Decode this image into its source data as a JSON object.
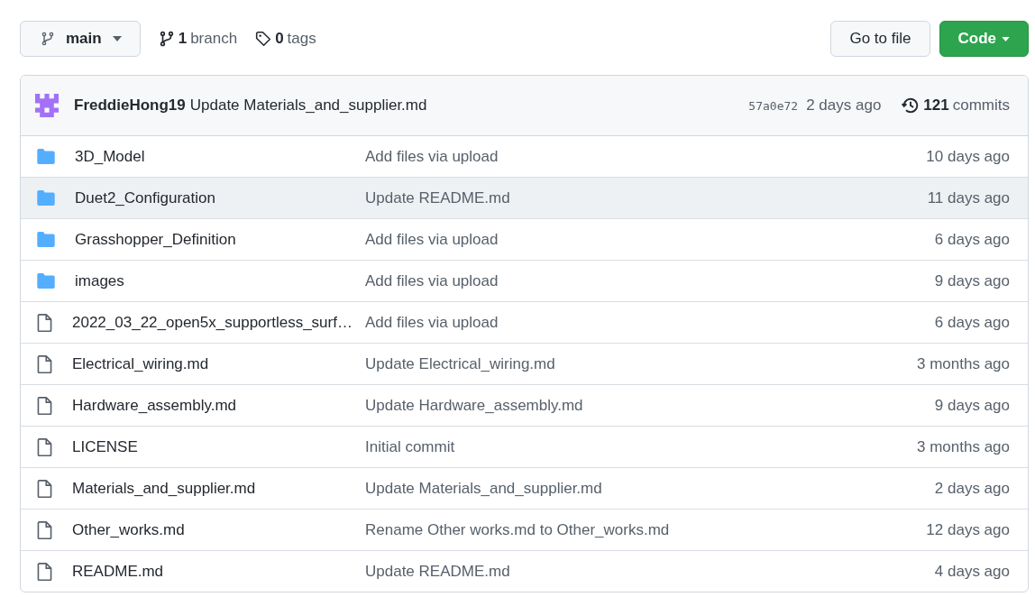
{
  "branch_selector": {
    "label": "main"
  },
  "branches": {
    "count": "1",
    "label": "branch"
  },
  "tags": {
    "count": "0",
    "label": "tags"
  },
  "buttons": {
    "go_to_file": "Go to file",
    "code": "Code"
  },
  "latest_commit": {
    "author": "FreddieHong19",
    "message": "Update Materials_and_supplier.md",
    "sha": "57a0e72",
    "time": "2 days ago",
    "commit_count": "121",
    "commit_label": "commits"
  },
  "files": [
    {
      "kind": "folder",
      "name": "3D_Model",
      "message": "Add files via upload",
      "time": "10 days ago",
      "selected": false
    },
    {
      "kind": "folder",
      "name": "Duet2_Configuration",
      "message": "Update README.md",
      "time": "11 days ago",
      "selected": true
    },
    {
      "kind": "folder",
      "name": "Grasshopper_Definition",
      "message": "Add files via upload",
      "time": "6 days ago",
      "selected": false
    },
    {
      "kind": "folder",
      "name": "images",
      "message": "Add files via upload",
      "time": "9 days ago",
      "selected": false
    },
    {
      "kind": "file",
      "name": "2022_03_22_open5x_supportless_surf…",
      "message": "Add files via upload",
      "time": "6 days ago",
      "selected": false
    },
    {
      "kind": "file",
      "name": "Electrical_wiring.md",
      "message": "Update Electrical_wiring.md",
      "time": "3 months ago",
      "selected": false
    },
    {
      "kind": "file",
      "name": "Hardware_assembly.md",
      "message": "Update Hardware_assembly.md",
      "time": "9 days ago",
      "selected": false
    },
    {
      "kind": "file",
      "name": "LICENSE",
      "message": "Initial commit",
      "time": "3 months ago",
      "selected": false
    },
    {
      "kind": "file",
      "name": "Materials_and_supplier.md",
      "message": "Update Materials_and_supplier.md",
      "time": "2 days ago",
      "selected": false
    },
    {
      "kind": "file",
      "name": "Other_works.md",
      "message": "Rename Other works.md to Other_works.md",
      "time": "12 days ago",
      "selected": false
    },
    {
      "kind": "file",
      "name": "README.md",
      "message": "Update README.md",
      "time": "4 days ago",
      "selected": false
    }
  ]
}
